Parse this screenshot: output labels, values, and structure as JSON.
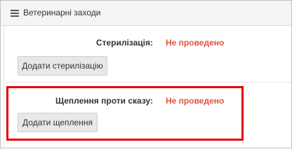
{
  "header": {
    "title": "Ветеринарні заходи",
    "icon": "list-icon"
  },
  "sterilization": {
    "label": "Стерилізація:",
    "status": "Не проведено",
    "button_label": "Додати стерилізацію"
  },
  "rabies_vaccination": {
    "label": "Щеплення проти сказу:",
    "status": "Не проведено",
    "button_label": "Додати щеплення"
  },
  "colors": {
    "status_not_done": "#e2513f",
    "highlight_border": "#e60000",
    "header_background": "#f5f5f5",
    "button_background": "#e8e8e8"
  }
}
